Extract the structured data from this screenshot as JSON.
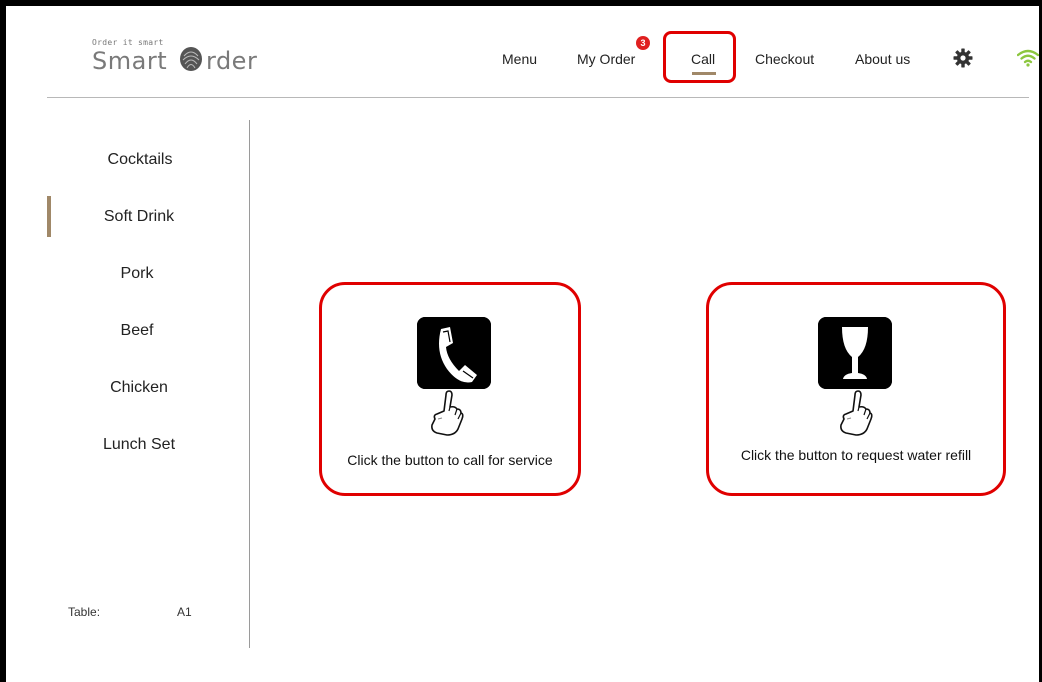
{
  "logo": {
    "tagline": "Order it smart",
    "word_a": "Smart",
    "word_b": "rder"
  },
  "topnav": {
    "items": [
      {
        "label": "Menu"
      },
      {
        "label": "My Order",
        "badge": "3"
      },
      {
        "label": "Call",
        "active": true
      },
      {
        "label": "Checkout"
      },
      {
        "label": "About us"
      }
    ]
  },
  "icons": {
    "settings": "gear-icon",
    "wifi": "wifi-icon",
    "service": "telephone-icon",
    "water": "wine-glass-icon",
    "pointer": "pointing-hand-icon"
  },
  "sidebar": {
    "items": [
      {
        "label": "Cocktails"
      },
      {
        "label": "Soft Drink",
        "selected": true
      },
      {
        "label": "Pork"
      },
      {
        "label": "Beef"
      },
      {
        "label": "Chicken"
      },
      {
        "label": "Lunch Set"
      }
    ],
    "table_label": "Table:",
    "table_value": "A1"
  },
  "main": {
    "call_service_text": "Click the button to call for service",
    "water_refill_text": "Click the button to request water refill"
  },
  "colors": {
    "accent": "#a08868",
    "highlight": "#e00000",
    "badge": "#e02020",
    "wifi": "#8cc63f"
  }
}
